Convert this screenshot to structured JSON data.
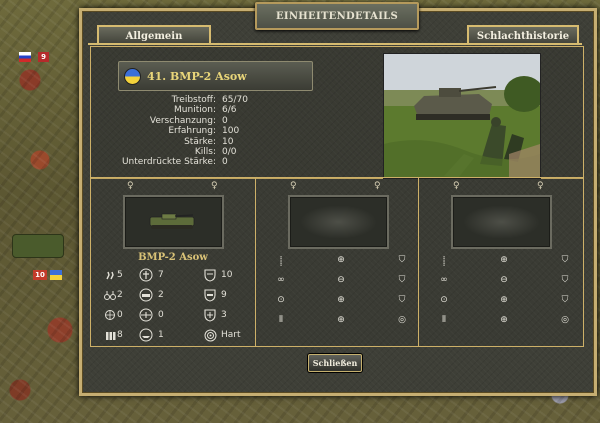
{
  "window": {
    "title": "EINHEITENDETAILS",
    "tabs": [
      {
        "label": "Allgemein",
        "active": true
      },
      {
        "label": "Schlachthistorie",
        "active": false
      }
    ],
    "close_label": "Schließen"
  },
  "unit": {
    "name": "41. BMP-2 Asow",
    "stats": [
      {
        "label": "Treibstoff:",
        "value": "65/70"
      },
      {
        "label": "Munition:",
        "value": "6/6"
      },
      {
        "label": "Verschanzung:",
        "value": "0"
      },
      {
        "label": "Erfahrung:",
        "value": "100"
      },
      {
        "label": "Stärke:",
        "value": "10"
      },
      {
        "label": "Kills:",
        "value": "0/0"
      },
      {
        "label": "Unterdrückte Stärke:",
        "value": "0"
      }
    ]
  },
  "panel1": {
    "name": "BMP-2 Asow",
    "rows": [
      {
        "left_icon": "movement-icon",
        "v1": "5",
        "mid_icon": "infantry-target-icon",
        "v2": "7",
        "right_icon": "defense-shield-icon",
        "v3": "10"
      },
      {
        "left_icon": "spotting-icon",
        "v1": "2",
        "mid_icon": "soft-target-icon",
        "v2": "2",
        "right_icon": "hard-defense-icon",
        "v3": "9"
      },
      {
        "left_icon": "initiative-icon",
        "v1": "0",
        "mid_icon": "air-target-icon",
        "v2": "0",
        "right_icon": "air-defense-icon",
        "v3": "3"
      },
      {
        "left_icon": "ammo-icon",
        "v1": "8",
        "mid_icon": "naval-target-icon",
        "v2": "1",
        "right_icon": "target-type-icon",
        "v3": "Hart"
      }
    ]
  },
  "map": {
    "marker_a": "9",
    "marker_b": "10"
  },
  "colors": {
    "frame_gold": "#c6ae72",
    "panel_bg": "#3e3f37",
    "unit_name": "#e9d67a"
  }
}
